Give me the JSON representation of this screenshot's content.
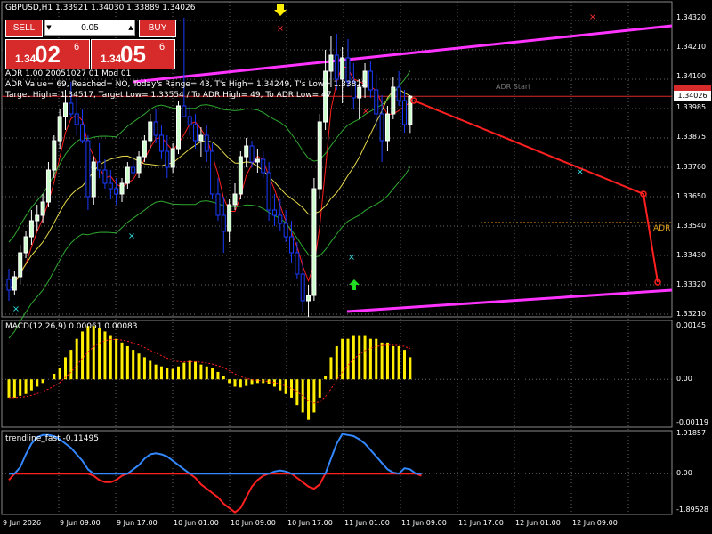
{
  "symbol_header": "GBPUSD,H1  1.33921 1.34030 1.33889 1.34026",
  "trade_panel": {
    "sell_label": "SELL",
    "buy_label": "BUY",
    "lot_value": "0.05",
    "sell_quote_small": "1.34",
    "sell_quote_big": "02",
    "sell_quote_sup": "6",
    "buy_quote_small": "1.34",
    "buy_quote_big": "05",
    "buy_quote_sup": "6"
  },
  "info_lines": [
    "ADR 1.00 20051027 01 Mod 01",
    "ADR Value= 69, Reached= NO, Today's Range= 43, T's High= 1.34249, T's Low= 1.33822",
    "Target High= 1.34517, Target Low= 1.33554 / To ADR High= 49, To ADR Low= 47"
  ],
  "adr_start_label": "ADR Start",
  "adr_label": "ADR",
  "price_axis": [
    "1.34320",
    "1.34210",
    "1.34100",
    "1.34026",
    "1.33985",
    "1.33875",
    "1.33760",
    "1.33650",
    "1.33540",
    "1.33430",
    "1.33320",
    "1.33210"
  ],
  "current_price": "1.34026",
  "macd_label": "MACD(12,26,9) 0.00061 0.00083",
  "macd_axis": [
    "0.00145",
    "0.00",
    "-0.00119"
  ],
  "trend_label": "trendline_fast -0.11495",
  "trend_axis": [
    "1.91857",
    "0.00",
    "-1.89528"
  ],
  "time_axis": [
    "9 Jun 2026",
    "9 Jun 09:00",
    "9 Jun 17:00",
    "10 Jun 01:00",
    "10 Jun 09:00",
    "10 Jun 17:00",
    "11 Jun 01:00",
    "11 Jun 09:00",
    "11 Jun 17:00",
    "12 Jun 01:00",
    "12 Jun 09:00"
  ],
  "colors": {
    "bull": "#ffffff",
    "bear": "#1a3aff",
    "bull_body": "#ccffcc",
    "channel": "#ff33ff",
    "ma_red": "#ff2020",
    "ma_yellow": "#e6d84a",
    "band_green": "#2fa82f",
    "macd_hist": "#ffee00",
    "trend_blue": "#3388ff",
    "trend_red": "#ff2020"
  },
  "chart_data": {
    "type": "candlestick",
    "candles": [
      [
        1.3334,
        1.3338,
        1.3326,
        1.333
      ],
      [
        1.333,
        1.3337,
        1.3328,
        1.3335
      ],
      [
        1.3335,
        1.3347,
        1.3332,
        1.3344
      ],
      [
        1.3344,
        1.3352,
        1.3342,
        1.335
      ],
      [
        1.335,
        1.336,
        1.3347,
        1.3356
      ],
      [
        1.3356,
        1.3362,
        1.3352,
        1.3358
      ],
      [
        1.3358,
        1.3366,
        1.3355,
        1.3363
      ],
      [
        1.3363,
        1.3378,
        1.3361,
        1.3375
      ],
      [
        1.3375,
        1.3388,
        1.3372,
        1.3386
      ],
      [
        1.3386,
        1.3398,
        1.3383,
        1.3395
      ],
      [
        1.3395,
        1.3405,
        1.339,
        1.34
      ],
      [
        1.34,
        1.3408,
        1.3395,
        1.3396
      ],
      [
        1.3396,
        1.3402,
        1.3388,
        1.3392
      ],
      [
        1.3392,
        1.3398,
        1.3385,
        1.3386
      ],
      [
        1.3386,
        1.3388,
        1.336,
        1.3365
      ],
      [
        1.3365,
        1.338,
        1.3362,
        1.3378
      ],
      [
        1.3378,
        1.3385,
        1.3372,
        1.3375
      ],
      [
        1.3375,
        1.3379,
        1.3368,
        1.337
      ],
      [
        1.337,
        1.3375,
        1.3364,
        1.3368
      ],
      [
        1.3368,
        1.3372,
        1.3362,
        1.3366
      ],
      [
        1.3366,
        1.3372,
        1.3363,
        1.337
      ],
      [
        1.337,
        1.3378,
        1.3368,
        1.3376
      ],
      [
        1.3376,
        1.338,
        1.3372,
        1.3374
      ],
      [
        1.3374,
        1.3382,
        1.3372,
        1.338
      ],
      [
        1.338,
        1.3388,
        1.3378,
        1.3386
      ],
      [
        1.3386,
        1.3396,
        1.3383,
        1.3393
      ],
      [
        1.3393,
        1.3398,
        1.3385,
        1.3388
      ],
      [
        1.3388,
        1.3392,
        1.3379,
        1.3382
      ],
      [
        1.3382,
        1.3388,
        1.3372,
        1.3376
      ],
      [
        1.3376,
        1.3385,
        1.3374,
        1.3383
      ],
      [
        1.3383,
        1.3401,
        1.3381,
        1.3399
      ],
      [
        1.3399,
        1.3432,
        1.3396,
        1.3395
      ],
      [
        1.3395,
        1.3399,
        1.3388,
        1.3392
      ],
      [
        1.3392,
        1.3396,
        1.3383,
        1.3386
      ],
      [
        1.3386,
        1.3391,
        1.338,
        1.3388
      ],
      [
        1.3388,
        1.3392,
        1.3378,
        1.3382
      ],
      [
        1.3382,
        1.3385,
        1.3364,
        1.3366
      ],
      [
        1.3366,
        1.3372,
        1.3356,
        1.3358
      ],
      [
        1.3358,
        1.3365,
        1.3344,
        1.3352
      ],
      [
        1.3352,
        1.3364,
        1.3348,
        1.3362
      ],
      [
        1.3362,
        1.337,
        1.336,
        1.3366
      ],
      [
        1.3366,
        1.3382,
        1.3364,
        1.338
      ],
      [
        1.338,
        1.3387,
        1.3376,
        1.3384
      ],
      [
        1.3384,
        1.3386,
        1.3376,
        1.3378
      ],
      [
        1.3378,
        1.3383,
        1.3374,
        1.3379
      ],
      [
        1.3379,
        1.3382,
        1.3372,
        1.3374
      ],
      [
        1.3374,
        1.3378,
        1.3356,
        1.336
      ],
      [
        1.336,
        1.3366,
        1.3354,
        1.3358
      ],
      [
        1.3358,
        1.3364,
        1.3352,
        1.3355
      ],
      [
        1.3355,
        1.336,
        1.3348,
        1.335
      ],
      [
        1.335,
        1.3356,
        1.334,
        1.3344
      ],
      [
        1.3344,
        1.3348,
        1.3334,
        1.3336
      ],
      [
        1.3336,
        1.3342,
        1.3322,
        1.3326
      ],
      [
        1.3326,
        1.3332,
        1.332,
        1.3328
      ],
      [
        1.3328,
        1.3372,
        1.3326,
        1.3368
      ],
      [
        1.3368,
        1.3396,
        1.3364,
        1.3393
      ],
      [
        1.3393,
        1.342,
        1.339,
        1.3412
      ],
      [
        1.3412,
        1.3425,
        1.3406,
        1.3418
      ],
      [
        1.3418,
        1.3426,
        1.3405,
        1.3409
      ],
      [
        1.3409,
        1.3421,
        1.34,
        1.3417
      ],
      [
        1.3417,
        1.3424,
        1.3406,
        1.3408
      ],
      [
        1.3408,
        1.3415,
        1.3398,
        1.3402
      ],
      [
        1.3402,
        1.3409,
        1.3394,
        1.3406
      ],
      [
        1.3406,
        1.3415,
        1.3402,
        1.3412
      ],
      [
        1.3412,
        1.3416,
        1.3402,
        1.3405
      ],
      [
        1.3405,
        1.3411,
        1.339,
        1.3396
      ],
      [
        1.3396,
        1.3403,
        1.3378,
        1.3386
      ],
      [
        1.3386,
        1.3399,
        1.3382,
        1.3396
      ],
      [
        1.3396,
        1.341,
        1.3394,
        1.3406
      ],
      [
        1.3406,
        1.3412,
        1.3399,
        1.3401
      ],
      [
        1.3401,
        1.3405,
        1.3389,
        1.3392
      ],
      [
        1.33921,
        1.3403,
        1.33889,
        1.34026
      ]
    ],
    "ylim": [
      1.332,
      1.3438
    ],
    "macd_values": [
      -0.0005,
      -0.0005,
      -0.00045,
      -0.0004,
      -0.0003,
      -0.0002,
      -0.0001,
      0.0,
      0.00015,
      0.0003,
      0.0006,
      0.0008,
      0.0011,
      0.0013,
      0.00145,
      0.00145,
      0.0014,
      0.0013,
      0.0012,
      0.0011,
      0.001,
      0.0009,
      0.0008,
      0.0007,
      0.0006,
      0.0005,
      0.0004,
      0.00035,
      0.0003,
      0.00028,
      0.00035,
      0.00045,
      0.0005,
      0.00048,
      0.0004,
      0.00035,
      0.0003,
      0.0002,
      0.0001,
      -0.0001,
      -0.0002,
      -0.00022,
      -0.00018,
      -0.00015,
      -0.0001,
      -0.0001,
      -0.00012,
      -0.0002,
      -0.0003,
      -0.0004,
      -0.0005,
      -0.0007,
      -0.0009,
      -0.0011,
      -0.0009,
      -0.0005,
      0.0001,
      0.0006,
      0.0009,
      0.0011,
      0.0011,
      0.0012,
      0.0012,
      0.0012,
      0.0011,
      0.0011,
      0.001,
      0.001,
      0.0009,
      0.0009,
      0.0008,
      0.0006
    ],
    "macd_ylim": [
      -0.0013,
      0.0016
    ],
    "trend_values": [
      -0.3,
      0.0,
      0.3,
      0.9,
      1.4,
      1.7,
      1.8,
      1.8,
      1.75,
      1.6,
      1.4,
      1.2,
      0.9,
      0.6,
      0.2,
      -0.1,
      -0.3,
      -0.4,
      -0.4,
      -0.3,
      -0.1,
      0.0,
      0.2,
      0.4,
      0.7,
      0.9,
      0.95,
      0.9,
      0.8,
      0.6,
      0.4,
      0.2,
      0.0,
      -0.2,
      -0.5,
      -0.7,
      -0.9,
      -1.1,
      -1.4,
      -1.6,
      -1.8,
      -1.6,
      -1.1,
      -0.6,
      -0.3,
      -0.1,
      0.0,
      0.1,
      0.15,
      0.1,
      0.0,
      -0.2,
      -0.4,
      -0.6,
      -0.7,
      -0.5,
      0.0,
      0.7,
      1.4,
      1.85,
      1.8,
      1.75,
      1.6,
      1.4,
      1.1,
      0.8,
      0.5,
      0.2,
      0.05,
      0.0,
      0.25,
      0.2,
      0.0,
      -0.1
    ],
    "trend_ylim": [
      -1.9,
      2.0
    ]
  }
}
